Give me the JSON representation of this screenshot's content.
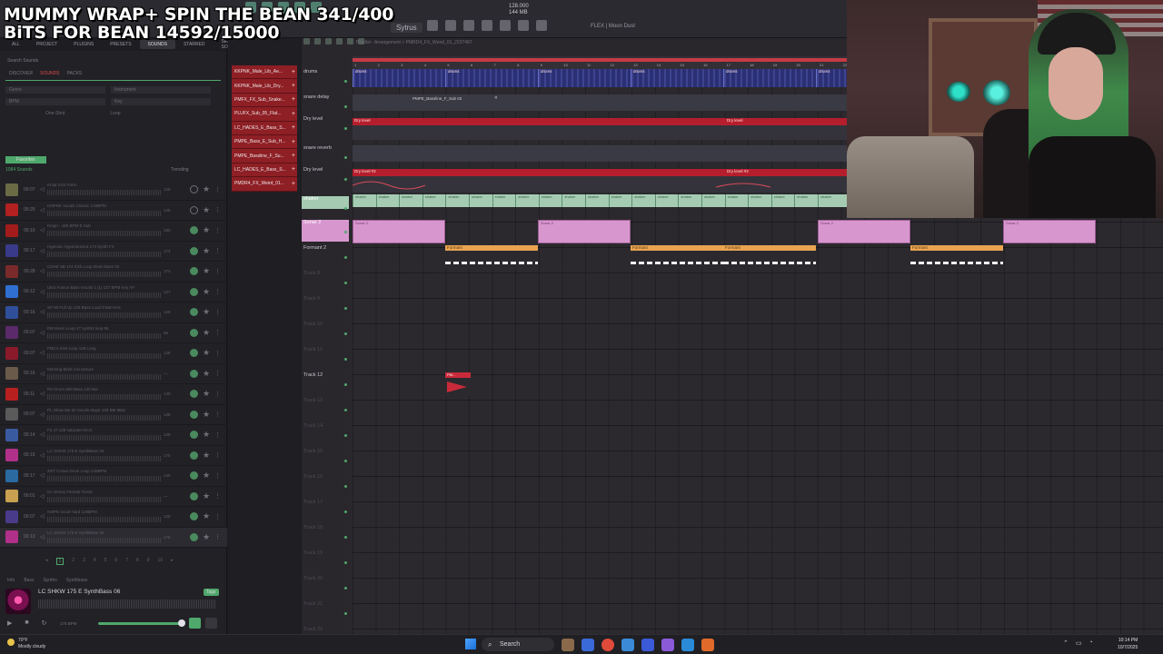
{
  "overlay": {
    "line1": "MUMMY WRAP+ SPIN THE BEAN 341/400",
    "line2": "BiTS FOR BEAN 14592/15000"
  },
  "toolbar": {
    "pattern": "Sytrus",
    "moon": "FLEX | Moon Dust",
    "time_top": "128.000",
    "time_bottom": "144 MB"
  },
  "browser": {
    "tabs": [
      "ALL",
      "PROJECT",
      "PLUGINS",
      "PRESETS",
      "SOUNDS",
      "STARRED",
      "SEX SOUNDS"
    ],
    "active_tab": "SOUNDS",
    "search_placeholder": "Search Sounds",
    "subtabs": [
      "DISCOVER",
      "SOUNDS",
      "PACKS"
    ],
    "filters": [
      "Genre",
      "Instrument",
      "BPM",
      "Key"
    ],
    "oneshot": [
      "One-Shot",
      "Loop"
    ],
    "favorites_label": "Favorites",
    "count": "1084 Sounds",
    "trending": "Trending",
    "samples": [
      {
        "dur": "00:07",
        "name": "Kmpt Kick Panic",
        "meta": "128",
        "ok": false,
        "color": "#6a6a45"
      },
      {
        "dur": "00:25",
        "name": "KMPNK Vocals Classic 128BPM",
        "meta": "128",
        "ok": false,
        "color": "#b32020"
      },
      {
        "dur": "00:10",
        "name": "Kmpn - 180 BPM E Sub",
        "meta": "180",
        "ok": true,
        "color": "#a31c1c"
      },
      {
        "dur": "00:17",
        "name": "Hypnotic Hypnotronica 174 Synth FX",
        "meta": "174",
        "ok": true,
        "color": "#3a3a8a"
      },
      {
        "dur": "00:28",
        "name": "CDHZ SB 174 Kick Loop Drum Bass 02",
        "meta": "174",
        "ok": true,
        "color": "#7a2a2a"
      },
      {
        "dur": "00:12",
        "name": "Ultra Fusion Bass Vocals 1 (1) 127 BPM Key A#",
        "meta": "127",
        "ok": true,
        "color": "#2f6fd0"
      },
      {
        "dur": "00:16",
        "name": "SP 80 Full Up 128 Bass Loud 8 Bar Kick",
        "meta": "128",
        "ok": true,
        "color": "#2f4f9a"
      },
      {
        "dur": "00:07",
        "name": "DM Moon Loop 47 synth2 loop 96",
        "meta": "96",
        "ok": true,
        "color": "#5a2a6a"
      },
      {
        "dur": "00:07",
        "name": "FMCA Kick Loop 128 Long",
        "meta": "128",
        "ok": true,
        "color": "#8a1a2a"
      },
      {
        "dur": "00:16",
        "name": "Morning Birds mix texture",
        "meta": "—",
        "ok": true,
        "color": "#6a5a4a"
      },
      {
        "dur": "00:11",
        "name": "RO Drum 808 Bass 140 Bar",
        "meta": "140",
        "ok": true,
        "color": "#b82020"
      },
      {
        "dur": "00:07",
        "name": "PL Show Me 02 Vocals Major 128 BM 9Bar",
        "meta": "128",
        "ok": true,
        "color": "#5a5a5a"
      },
      {
        "dur": "00:14",
        "name": "F2 47 128 saturate KICK",
        "meta": "128",
        "ok": true,
        "color": "#3a5aa0"
      },
      {
        "dur": "00:15",
        "name": "LC SHKW 175 E SynthBass 03",
        "meta": "175",
        "ok": true,
        "color": "#b0308a"
      },
      {
        "dur": "00:17",
        "name": "ZGT Crown Drum Loop 140BPM",
        "meta": "140",
        "ok": true,
        "color": "#2a6aa0"
      },
      {
        "dur": "00:01",
        "name": "DJ Jersey Female Fiesta",
        "meta": "—",
        "ok": true,
        "color": "#c9a050"
      },
      {
        "dur": "00:07",
        "name": "KMPN Vocal Hard 128BPM",
        "meta": "128",
        "ok": true,
        "color": "#4a3a8a"
      },
      {
        "dur": "00:13",
        "name": "LC SHKW 175 E SynthBass 06",
        "meta": "175",
        "ok": true,
        "color": "#b0308a"
      }
    ],
    "pages": [
      "1",
      "2",
      "3",
      "4",
      "5",
      "6",
      "7",
      "8",
      "9",
      "10"
    ],
    "active_page": "1",
    "footer_tabs": [
      "Info",
      "Bass",
      "Synths",
      "Synthbass"
    ],
    "preview_name": "LC SHKW 175 E SynthBass 06",
    "preview_tag": "Tags",
    "preview_bpm": "175 BPM"
  },
  "channels": [
    "KKPNK_Male_Lib_Ae...",
    "KKPNK_Male_Lib_Dry...",
    "PMFX_FX_Sub_Snake...",
    "PLUFX_Sub_05_Flat...",
    "LC_HADES_E_Bass_S...",
    "PMPE_Bass_E_Sub_H...",
    "PMPE_Bassline_F_Su...",
    "LC_HADES_E_Bass_S...",
    "PMDR4_FX_Weird_01..."
  ],
  "playlist": {
    "title": "Playlist - Arrangement > PMRD4_FX_Weird_01_2237487",
    "ruler": [
      "1",
      "2",
      "3",
      "4",
      "5",
      "6",
      "7",
      "8",
      "9",
      "10",
      "11",
      "12",
      "13",
      "14",
      "15",
      "16",
      "17",
      "18",
      "19",
      "20",
      "21",
      "22"
    ],
    "tracks": [
      "drums",
      "snare delay",
      "Dry level",
      "snare reverb",
      "Dry level",
      "shaker",
      "Sonar 2",
      "Formant 2",
      "Track 8",
      "Track 9",
      "Track 10",
      "Track 11",
      "Track 12",
      "Track 13",
      "Track 14",
      "Track 15",
      "Track 16",
      "Track 17",
      "Track 18",
      "Track 19",
      "Track 20",
      "Track 21",
      "Track 22"
    ],
    "drums_clip": "drums",
    "bass_clip": "PMPE_Bassline_F_Sub 02",
    "dry_clip": "Dry level",
    "dry_clip2": "Dry level #2",
    "shaker_clip": "shaker",
    "sonar_clip": "Sonar 2",
    "formant_clip": "Formant",
    "fx_clip": "PM..."
  },
  "taskbar": {
    "temp": "70°F",
    "weather": "Mostly cloudy",
    "search": "Search",
    "time": "10:14 PM",
    "date": "10/7/2025"
  }
}
